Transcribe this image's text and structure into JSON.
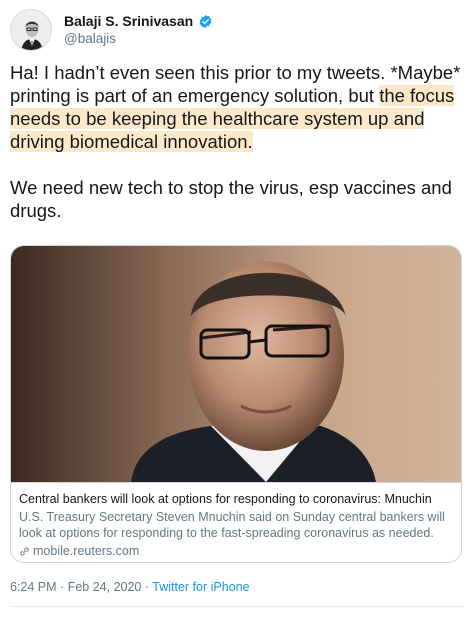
{
  "author": {
    "name": "Balaji S. Srinivasan",
    "handle": "@balajis",
    "verified_color": "#1da1f2"
  },
  "tweet": {
    "para1_plain": "Ha! I hadn’t even seen this prior to my tweets. *Maybe* printing is part of an emergency solution, but ",
    "para1_highlight": "the focus needs to be keeping the healthcare system up and driving biomedical innovation.",
    "para2": "We need new tech to stop the virus, esp vaccines and drugs.",
    "highlight_color": "#fde9c9"
  },
  "card": {
    "title": "Central bankers will look at options for responding to coronavirus: Mnuchin",
    "description": "U.S. Treasury Secretary Steven Mnuchin said on Sunday central bankers will look at options for responding to the fast-spreading coronavirus as needed.",
    "domain": "mobile.reuters.com",
    "image_icon": "portrait-photo-icon"
  },
  "meta": {
    "time": "6:24 PM",
    "separator": "·",
    "date": "Feb 24, 2020",
    "source": "Twitter for iPhone"
  }
}
